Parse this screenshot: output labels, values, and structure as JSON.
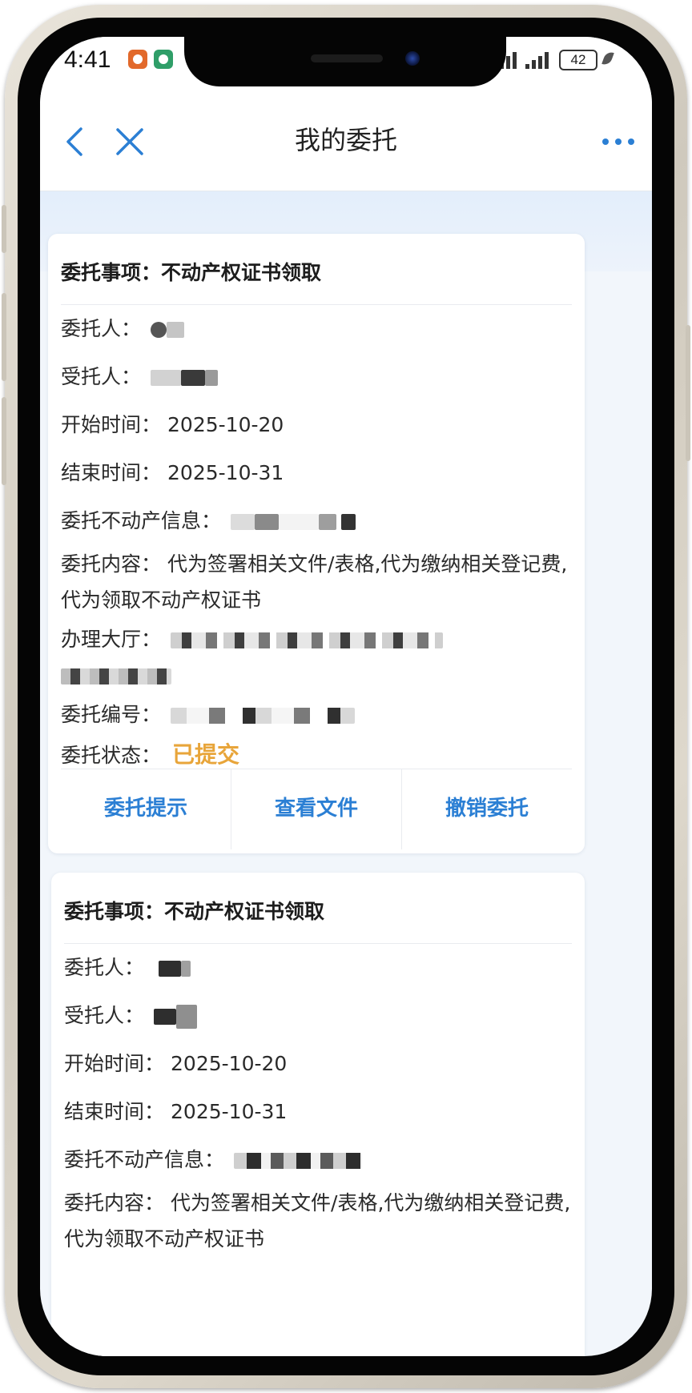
{
  "status_bar": {
    "time": "4:41",
    "battery": "42"
  },
  "nav": {
    "title": "我的委托"
  },
  "labels": {
    "item": "委托事项：",
    "principal": "委托人：",
    "agent": "受托人：",
    "start_time": "开始时间：",
    "end_time": "结束时间：",
    "property_info": "委托不动产信息：",
    "content": "委托内容：",
    "hall": "办理大厅：",
    "number": "委托编号：",
    "status": "委托状态："
  },
  "cards": [
    {
      "item": "不动产权证书领取",
      "start_time": "2025-10-20",
      "end_time": "2025-10-31",
      "content": "代为签署相关文件/表格,代为缴纳相关登记费,代为领取不动产权证书",
      "status": "已提交",
      "actions": [
        "委托提示",
        "查看文件",
        "撤销委托"
      ]
    },
    {
      "item": "不动产权证书领取",
      "start_time": "2025-10-20",
      "end_time": "2025-10-31",
      "content": "代为签署相关文件/表格,代为缴纳相关登记费,代为领取不动产权证书"
    }
  ],
  "colors": {
    "accent": "#2b7fd4",
    "status_submitted": "#e8a53a",
    "band": "#e3eefb"
  },
  "icons": {
    "back": "back-arrow-icon",
    "close": "close-icon",
    "more": "more-icon"
  }
}
